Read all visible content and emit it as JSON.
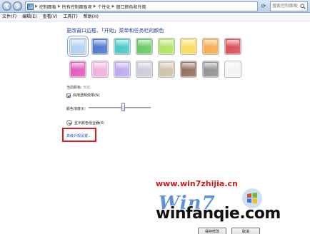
{
  "address_bar": {
    "crumbs": [
      "控制面板",
      "所有控制面板项",
      "个性化",
      "窗口颜色和外观"
    ],
    "search_placeholder": "搜索控制面板"
  },
  "menu": [
    "文件(F)",
    "编辑(E)",
    "查看(V)",
    "工具(T)",
    "帮助(H)"
  ],
  "page": {
    "title": "更改窗口边框、「开始」菜单和任务栏的颜色",
    "current_color_label": "当前颜色:",
    "current_color_value": "天空",
    "transparency_label": "启用透明效果(N)",
    "transparency_checked": true,
    "intensity_label": "颜色浓度(I):",
    "intensity_value": 0.55,
    "mixer_label": "显示颜色混合器(X)",
    "advanced_link": "高级外观设置..."
  },
  "swatches": [
    {
      "name": "sky",
      "color": "#a9cdf0",
      "selected": true
    },
    {
      "name": "twilight",
      "color": "#3f6fc9"
    },
    {
      "name": "sea",
      "color": "#3fc4c3"
    },
    {
      "name": "leaf",
      "color": "#5cc65a"
    },
    {
      "name": "lime",
      "color": "#aee05a"
    },
    {
      "name": "sun",
      "color": "#f7d94f"
    },
    {
      "name": "pumpkin",
      "color": "#f5a640"
    },
    {
      "name": "ruby",
      "color": "#d8424a"
    },
    {
      "name": "fuchsia",
      "color": "#e04fba"
    },
    {
      "name": "blush",
      "color": "#f0a9d9"
    },
    {
      "name": "violet",
      "color": "#b9a2e9"
    },
    {
      "name": "lavender",
      "color": "#c9c7d9"
    },
    {
      "name": "taupe",
      "color": "#c9bfa6"
    },
    {
      "name": "chocolate",
      "color": "#8b6552"
    },
    {
      "name": "slate",
      "color": "#8a8a8a"
    },
    {
      "name": "frost",
      "color": "#f2f2f2"
    }
  ],
  "buttons": {
    "save": "保存修改",
    "cancel": "取消"
  },
  "watermark": {
    "url": "www.win7zhijia.cn",
    "logo_text": "Win7",
    "site": "winfanqie.com"
  },
  "colors": {
    "title_blue": "#1e3f91",
    "highlight_red": "#e01a1a",
    "link_blue": "#1a4fb5"
  }
}
